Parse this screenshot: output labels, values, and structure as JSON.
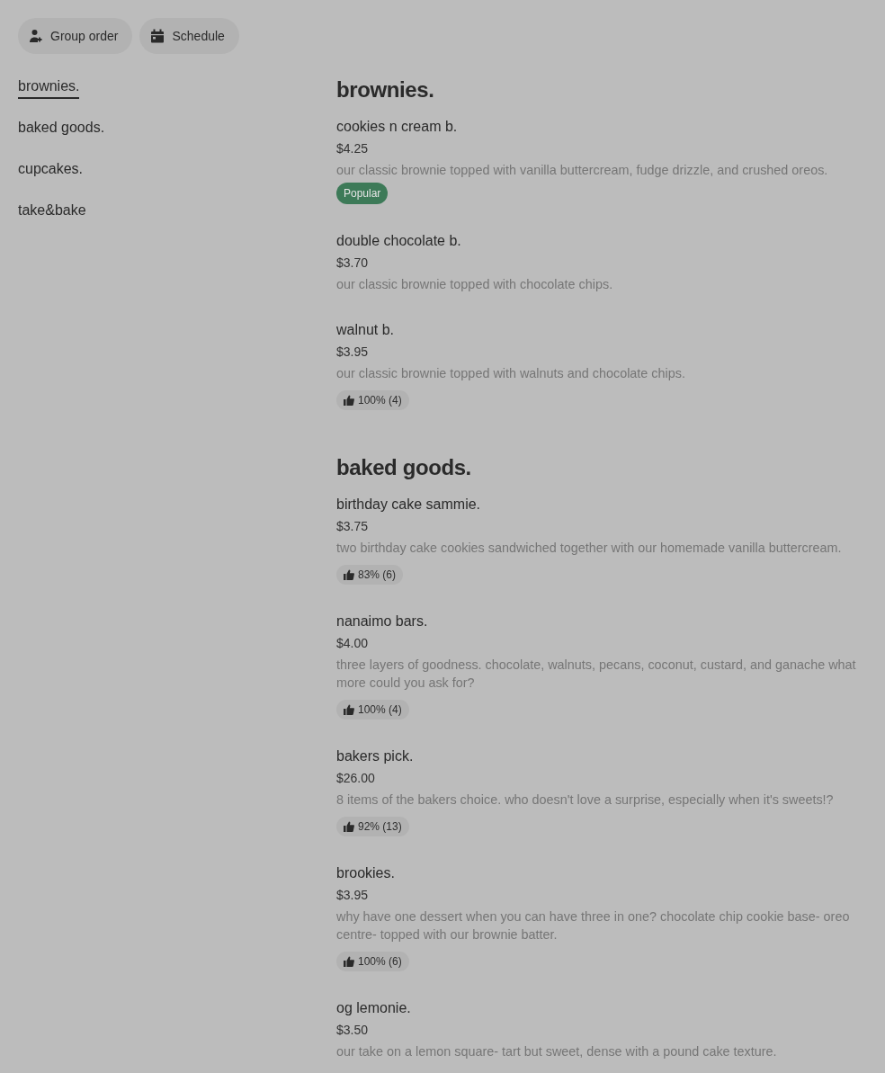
{
  "toolbar": {
    "buttons": [
      {
        "kind": "group",
        "label": "Group order"
      },
      {
        "kind": "schedule",
        "label": "Schedule"
      }
    ]
  },
  "sidebar": {
    "items": [
      {
        "label": "brownies.",
        "selected": true
      },
      {
        "label": "baked goods.",
        "selected": false
      },
      {
        "label": "cupcakes.",
        "selected": false
      },
      {
        "label": "take&bake",
        "selected": false
      }
    ]
  },
  "sections": [
    {
      "title": "brownies.",
      "items": [
        {
          "name": "cookies n cream b.",
          "price": "$4.25",
          "description": "our classic brownie topped with vanilla buttercream, fudge drizzle, and crushed oreos.",
          "tag": {
            "kind": "popular",
            "text": "Popular"
          }
        },
        {
          "name": "double chocolate b.",
          "price": "$3.70",
          "description": "our classic brownie topped with chocolate chips."
        },
        {
          "name": "walnut b.",
          "price": "$3.95",
          "description": "our classic brownie topped with walnuts and chocolate chips.",
          "tag": {
            "kind": "rating",
            "text": "100% (4)"
          }
        }
      ]
    },
    {
      "title": "baked goods.",
      "items": [
        {
          "name": "birthday cake sammie.",
          "price": "$3.75",
          "description": "two birthday cake cookies sandwiched together with our homemade vanilla buttercream.",
          "tag": {
            "kind": "rating",
            "text": "83% (6)"
          }
        },
        {
          "name": "nanaimo bars.",
          "price": "$4.00",
          "description": "three layers of goodness. chocolate, walnuts, pecans, coconut, custard, and ganache what more could you ask for?",
          "tag": {
            "kind": "rating",
            "text": "100% (4)"
          }
        },
        {
          "name": "bakers pick.",
          "price": "$26.00",
          "description": "8 items of the bakers choice. who doesn't love a surprise, especially when it's sweets!?",
          "tag": {
            "kind": "rating",
            "text": "92% (13)"
          }
        },
        {
          "name": "brookies.",
          "price": "$3.95",
          "description": "why have one dessert when you can have three in one? chocolate chip cookie base- oreo centre- topped with our brownie batter.",
          "tag": {
            "kind": "rating",
            "text": "100% (6)"
          }
        },
        {
          "name": "og lemonie.",
          "price": "$3.50",
          "description": "our take on a lemon square- tart but sweet, dense with a pound cake texture."
        }
      ]
    }
  ]
}
